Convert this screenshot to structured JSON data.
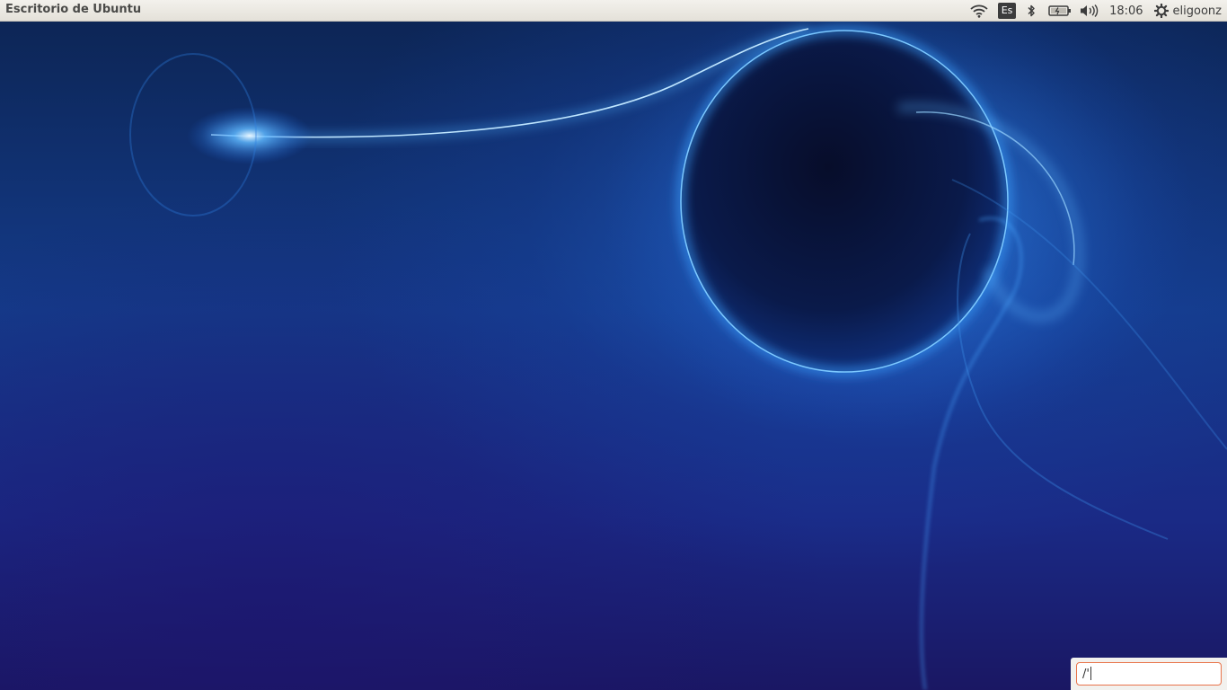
{
  "panel": {
    "window_title": "Escritorio de Ubuntu",
    "keyboard_layout": "Es",
    "clock": "18:06",
    "user_name": "eligoonz",
    "icons": [
      "wifi-icon",
      "bluetooth-icon",
      "battery-icon",
      "volume-icon",
      "gear-icon"
    ]
  },
  "typeahead": {
    "value": "/'"
  },
  "colors": {
    "panel_bg": "#e4e1d9",
    "panel_text": "#3c3c3c",
    "input_border": "#e9744a",
    "wallpaper_base": "#143b8a"
  }
}
